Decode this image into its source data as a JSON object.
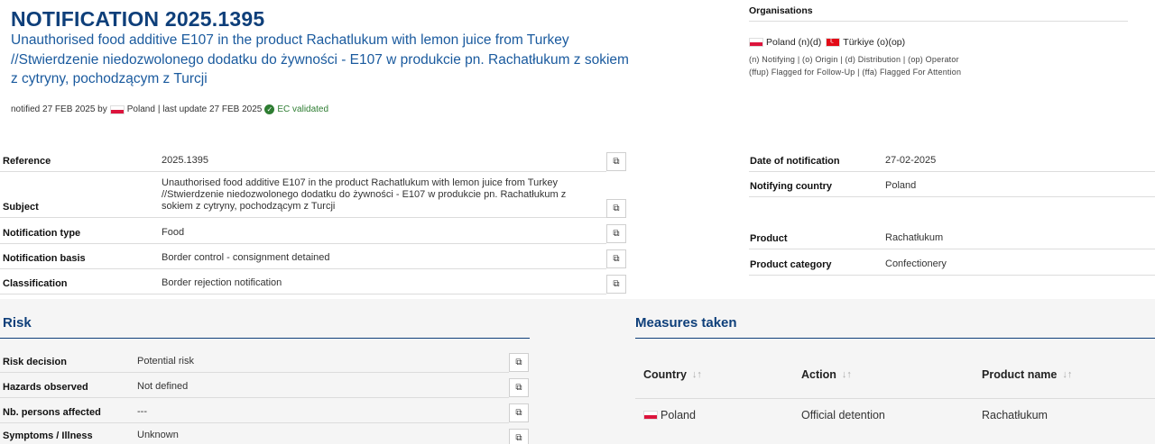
{
  "header": {
    "title": "NOTIFICATION 2025.1395",
    "subtitle": "Unauthorised food additive E107 in the product Rachatlukum with lemon juice from Turkey //Stwierdzenie niedozwolonego dodatku do żywności - E107 w produkcie pn. Rachatłukum z sokiem z cytryny, pochodzącym z Turcji",
    "notified_prefix": "notified 27 FEB 2025 by",
    "notified_country": "Poland",
    "last_update": "| last update 27 FEB 2025",
    "validated": "EC validated"
  },
  "organisations": {
    "title": "Organisations",
    "items": [
      {
        "label": "Poland (n)(d)",
        "flag": "flag-poland-icon"
      },
      {
        "label": "Türkiye (o)(op)",
        "flag": "flag-turkey-icon"
      }
    ],
    "legend_1": "(n) Notifying | (o) Origin | (d) Distribution | (op) Operator",
    "legend_2": "(ffup) Flagged for Follow-Up | (ffa) Flagged For Attention"
  },
  "details_left": {
    "reference_label": "Reference",
    "reference": "2025.1395",
    "subject_label": "Subject",
    "subject": "Unauthorised food additive E107 in the product Rachatlukum with lemon juice from Turkey //Stwierdzenie niedozwolonego dodatku do żywności - E107 w produkcie pn. Rachatłukum z sokiem z cytryny, pochodzącym z Turcji",
    "type_label": "Notification type",
    "type": "Food",
    "basis_label": "Notification basis",
    "basis": "Border control - consignment detained",
    "class_label": "Classification",
    "class": "Border rejection notification"
  },
  "details_right": {
    "date_label": "Date of notification",
    "date": "27-02-2025",
    "country_label": "Notifying country",
    "country": "Poland",
    "product_label": "Product",
    "product": "Rachatłukum",
    "category_label": "Product category",
    "category": "Confectionery"
  },
  "risk": {
    "title": "Risk",
    "decision_label": "Risk decision",
    "decision": "Potential risk",
    "hazards_label": "Hazards observed",
    "hazards": "Not defined",
    "persons_label": "Nb. persons affected",
    "persons": "---",
    "symptoms_label": "Symptoms / Illness",
    "symptoms": "Unknown"
  },
  "measures": {
    "title": "Measures taken",
    "columns": [
      "Country",
      "Action",
      "Product name"
    ],
    "rows": [
      {
        "country": "Poland",
        "action": "Official detention",
        "product": "Rachatłukum"
      }
    ]
  },
  "icons": {
    "copy": "copy-icon",
    "sort": "sort-icon",
    "check": "check-circle-icon"
  },
  "colors": {
    "title": "#0e3f7a",
    "subtitle": "#1a5a9e",
    "validated": "#2e7d32"
  }
}
